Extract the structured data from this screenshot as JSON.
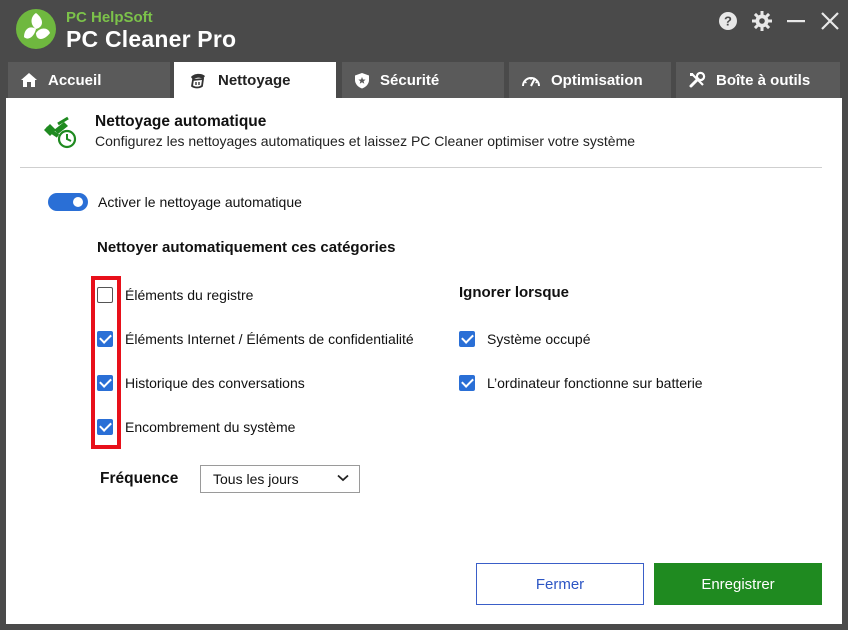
{
  "app": {
    "vendor": "PC HelpSoft",
    "name": "PC Cleaner Pro"
  },
  "window_controls": [
    "help-icon",
    "gear-icon",
    "minimize-icon",
    "close-icon"
  ],
  "tabs": [
    {
      "label": "Accueil",
      "icon": "home-icon",
      "active": false
    },
    {
      "label": "Nettoyage",
      "icon": "broom-icon",
      "active": true
    },
    {
      "label": "Sécurité",
      "icon": "shield-icon",
      "active": false
    },
    {
      "label": "Optimisation",
      "icon": "gauge-icon",
      "active": false
    },
    {
      "label": "Boîte à outils",
      "icon": "tools-icon",
      "active": false
    }
  ],
  "header": {
    "title": "Nettoyage automatique",
    "subtitle": "Configurez les nettoyages automatiques et laissez PC Cleaner optimiser votre système",
    "icon": "auto-clean-icon"
  },
  "auto_clean": {
    "label": "Activer le nettoyage automatique",
    "enabled": true
  },
  "categories": {
    "title": "Nettoyer automatiquement ces catégories",
    "items": [
      {
        "label": "Éléments du registre",
        "checked": false
      },
      {
        "label": "Éléments Internet / Éléments de confidentialité",
        "checked": true
      },
      {
        "label": "Historique des conversations",
        "checked": true
      },
      {
        "label": "Encombrement du système",
        "checked": true
      }
    ]
  },
  "ignore": {
    "title": "Ignorer lorsque",
    "items": [
      {
        "label": "Système occupé",
        "checked": true
      },
      {
        "label": "L’ordinateur fonctionne sur batterie",
        "checked": true
      }
    ]
  },
  "frequency": {
    "label": "Fréquence",
    "value": "Tous les jours"
  },
  "buttons": {
    "close": "Fermer",
    "save": "Enregistrer"
  },
  "colors": {
    "titlebar": "#4a4a4a",
    "accent_blue": "#2a6fd6",
    "save_green": "#1f8a20",
    "highlight_red": "#e8101a",
    "brand_green": "#7cc24a"
  }
}
